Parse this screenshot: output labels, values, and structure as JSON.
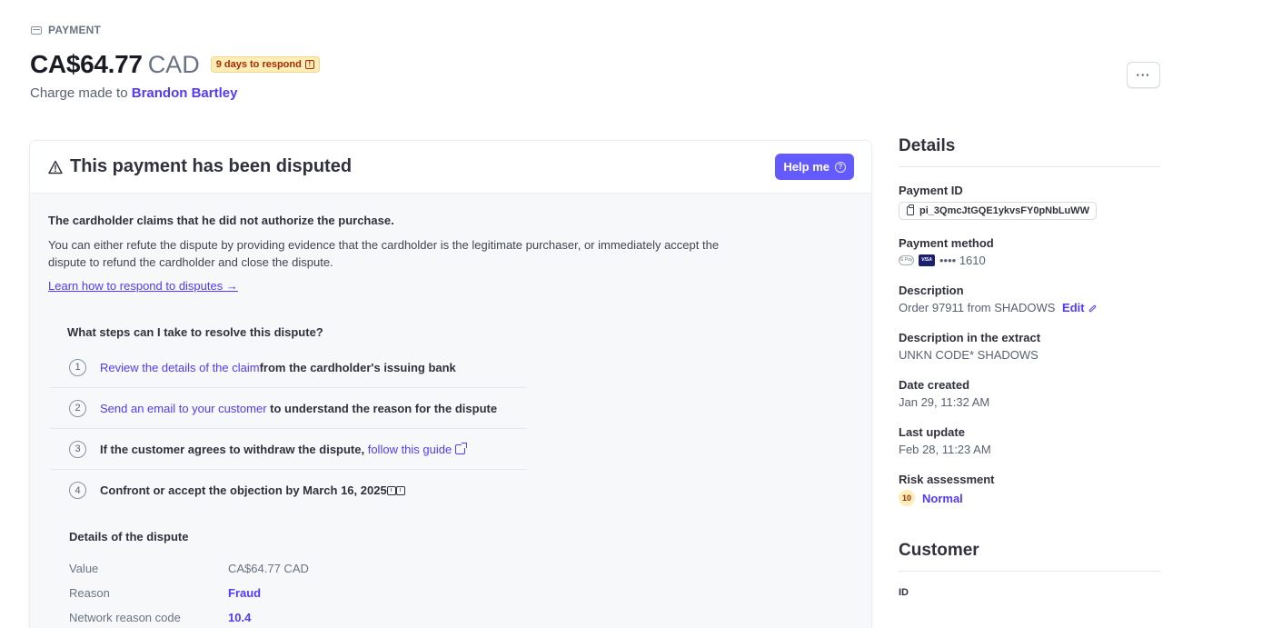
{
  "header": {
    "eyebrow": "PAYMENT",
    "amount": "CA$64.77",
    "currency": "CAD",
    "deadline_badge": "9 days to respond",
    "charge_prefix": "Charge made to ",
    "customer_name": "Brandon Bartley",
    "more_label": "···"
  },
  "dispute_card": {
    "title": "This payment has been disputed",
    "help_label": "Help me",
    "claim_title": "The cardholder claims that he did not authorize the purchase.",
    "claim_body": "You can either refute the dispute by providing evidence that the cardholder is the legitimate purchaser, or immediately accept the dispute to refund the cardholder and close the dispute.",
    "learn_link": "Learn how to respond to disputes →",
    "steps_title": "What steps can I take to resolve this dispute?",
    "steps": [
      {
        "num": "1",
        "link": "Review the details of the claim",
        "text": "from the cardholder's issuing bank"
      },
      {
        "num": "2",
        "link": "Send an email to your customer",
        "text": " to understand the reason for the dispute"
      },
      {
        "num": "3",
        "text": "If the customer agrees to withdraw the dispute, ",
        "link": "follow this guide"
      },
      {
        "num": "4",
        "text": "Confront or accept the objection by March 16, 2025"
      }
    ],
    "details_title": "Details of the dispute",
    "details": [
      {
        "key": "Value",
        "value": "CA$64.77 CAD"
      },
      {
        "key": "Reason",
        "value": "Fraud"
      },
      {
        "key": "Network reason code",
        "value": "10.4"
      }
    ]
  },
  "sidebar": {
    "details_heading": "Details",
    "payment_id_label": "Payment ID",
    "payment_id": "pi_3QmcJtGQE1ykvsFY0pNbLuWW",
    "payment_method_label": "Payment method",
    "gpay_mark": "G Pay",
    "card_brand": "VISA",
    "card_last4": "•••• 1610",
    "description_label": "Description",
    "description": "Order 97911 from SHADOWS",
    "edit_label": "Edit",
    "extract_label": "Description in the extract",
    "extract": "UNKN CODE* SHADOWS",
    "date_created_label": "Date created",
    "date_created": "Jan 29, 11:32 AM",
    "last_update_label": "Last update",
    "last_update": "Feb 28, 11:23 AM",
    "risk_label": "Risk assessment",
    "risk_score": "10",
    "risk_level": "Normal",
    "customer_heading": "Customer",
    "customer_id_label": "ID"
  },
  "colors": {
    "accent": "#533afd",
    "help_button": "#635bff",
    "badge_bg": "#fcedb9",
    "badge_text": "#a82c00"
  }
}
